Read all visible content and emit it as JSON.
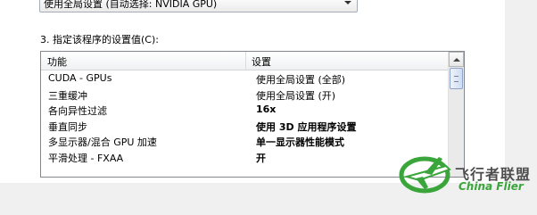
{
  "dropdown": {
    "value": "使用全局设置 (自动选择: NVIDIA GPU)"
  },
  "section": {
    "label": "3. 指定该程序的设置值(C):"
  },
  "list": {
    "columns": [
      "功能",
      "设置"
    ],
    "rows": [
      {
        "feature": "CUDA - GPUs",
        "setting": "使用全局设置 (全部)",
        "bold": false
      },
      {
        "feature": "三重缓冲",
        "setting": "使用全局设置 (开)",
        "bold": false
      },
      {
        "feature": "各向异性过滤",
        "setting": "16x",
        "bold": true
      },
      {
        "feature": "垂直同步",
        "setting": "使用 3D 应用程序设置",
        "bold": true
      },
      {
        "feature": "多显示器/混合 GPU 加速",
        "setting": "单一显示器性能模式",
        "bold": true
      },
      {
        "feature": "平滑处理 - FXAA",
        "setting": "开",
        "bold": true
      }
    ]
  },
  "watermark": {
    "cn": "飞行者联盟",
    "en": "China Flier",
    "color": "#3aa53a"
  }
}
